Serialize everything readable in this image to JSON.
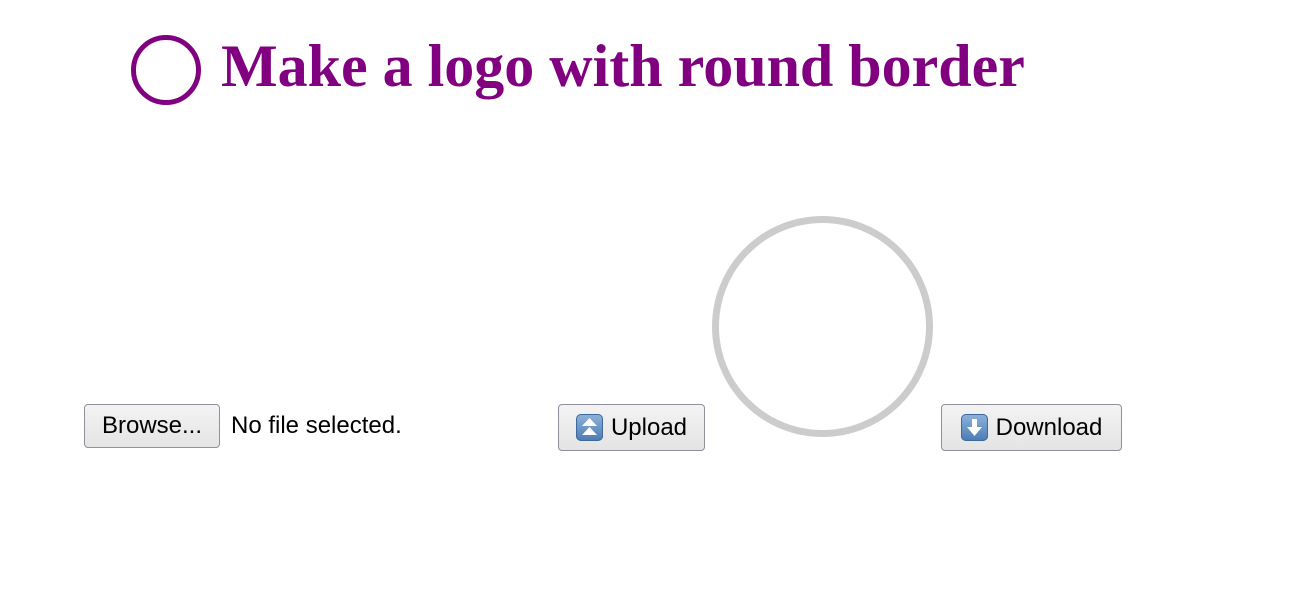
{
  "header": {
    "title": "Make a logo with round border",
    "title_color": "#800080",
    "logo_icon": "circle-outline-icon"
  },
  "preview": {
    "ring_color": "#cccccc",
    "ring_icon": "circle-outline-icon"
  },
  "file_input": {
    "browse_label": "Browse...",
    "status": "No file selected."
  },
  "actions": {
    "upload_label": "Upload",
    "upload_icon": "double-up-arrow-icon",
    "download_label": "Download",
    "download_icon": "down-arrow-icon"
  }
}
